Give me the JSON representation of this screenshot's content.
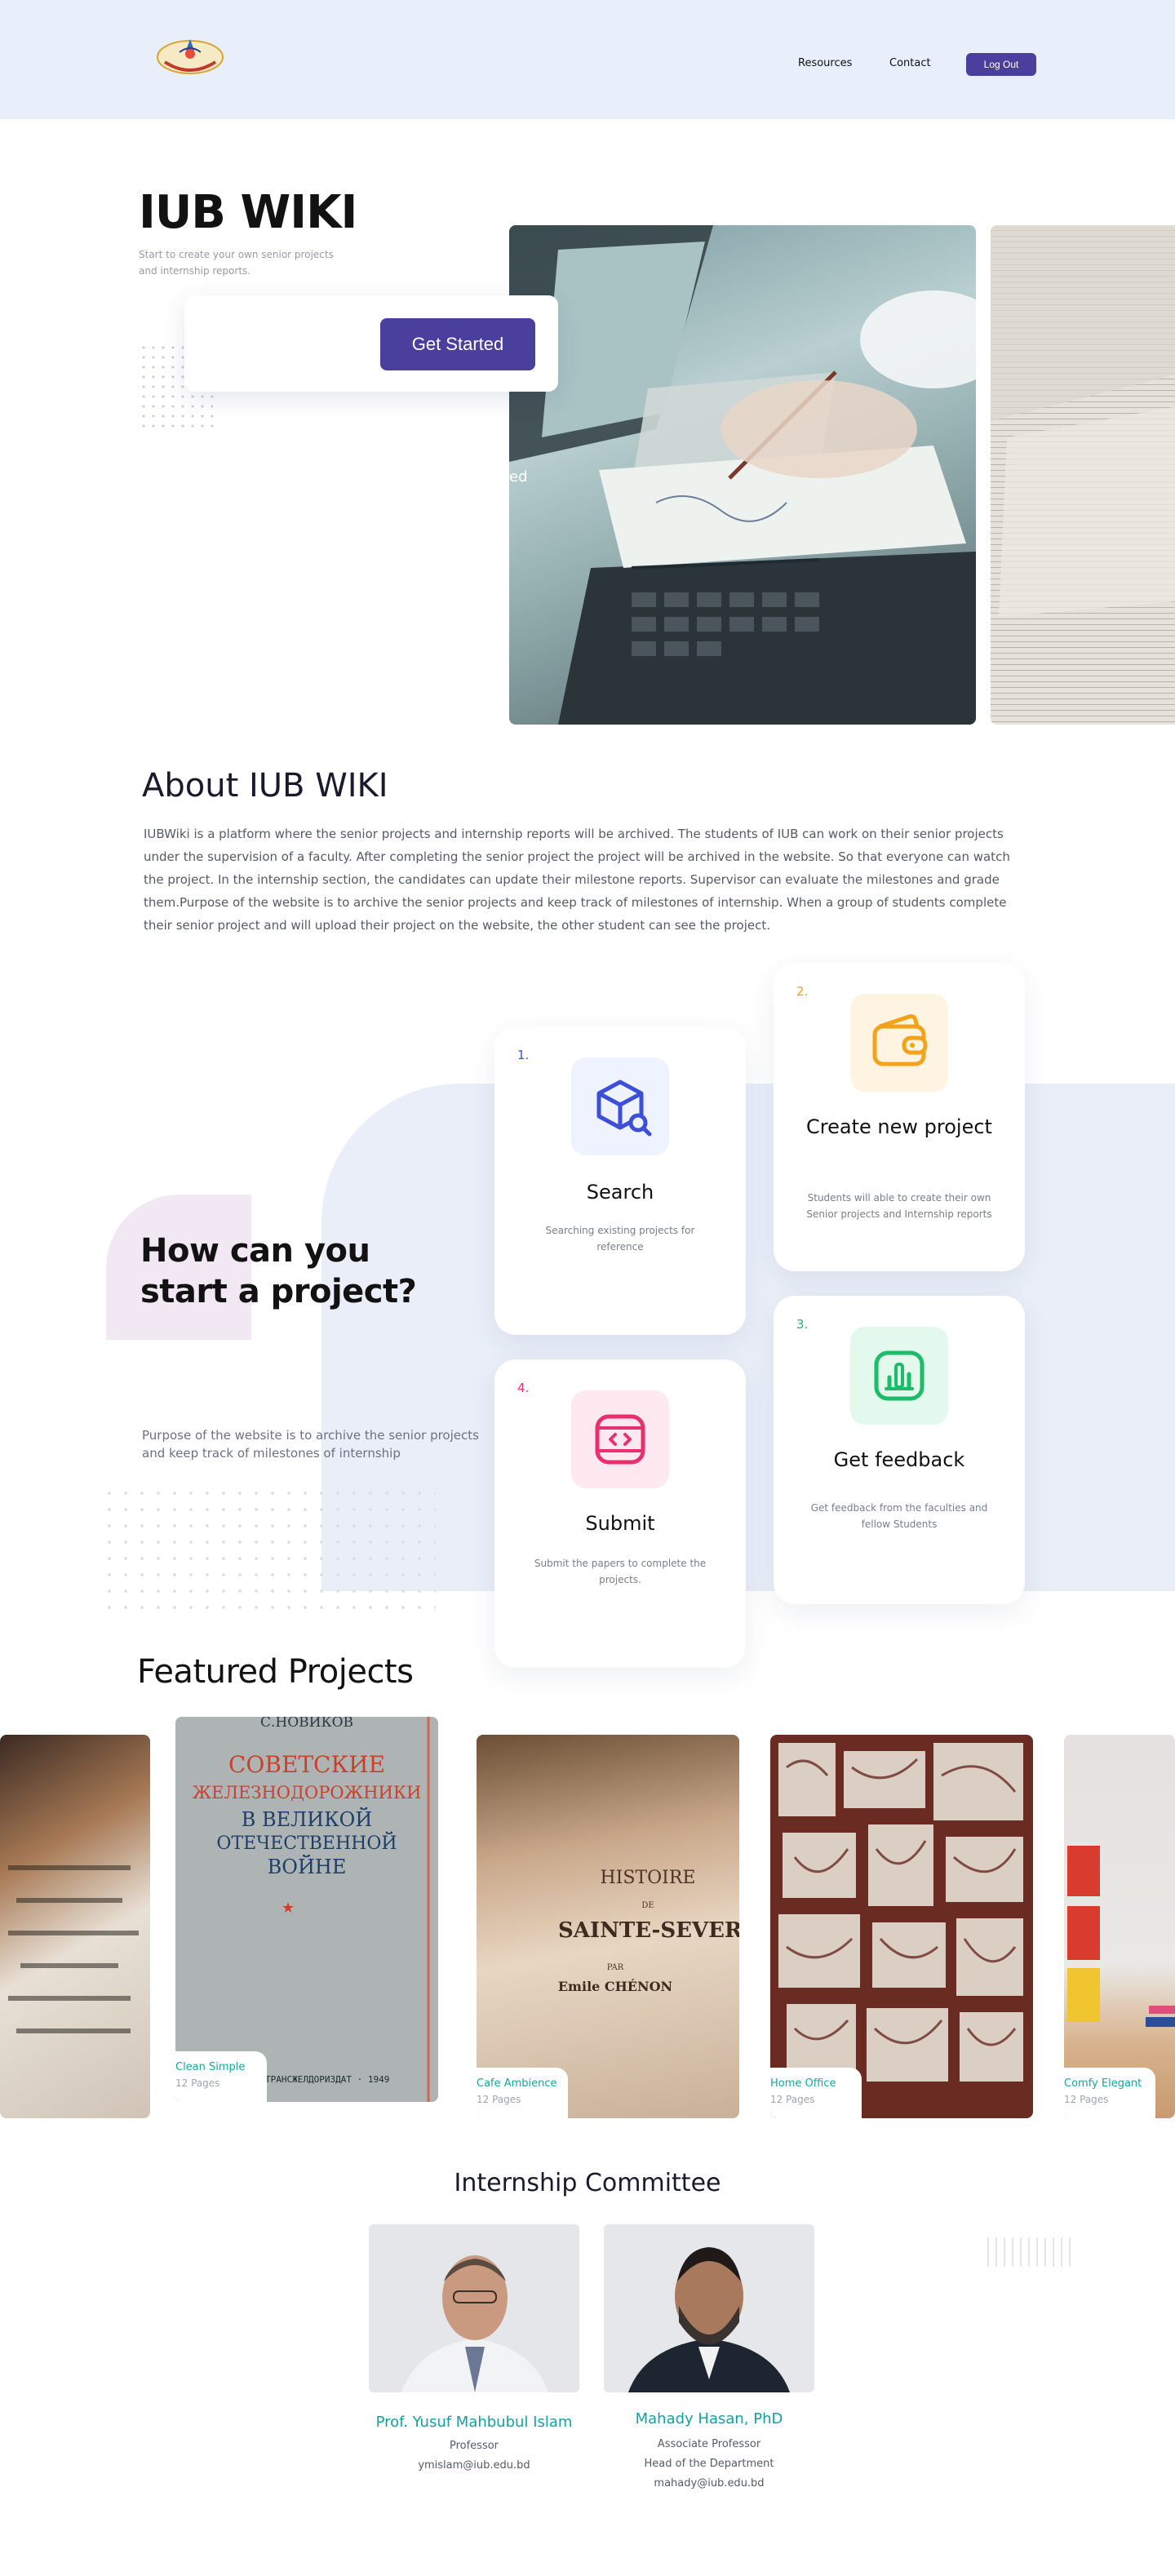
{
  "header": {
    "nav": [
      "Resources",
      "Contact"
    ],
    "logout_label": "Log Out"
  },
  "hero": {
    "title": "IUB WIKI",
    "subtitle": "Start to create your own senior projects and internship reports.",
    "cta_label": "Get Started",
    "fragment": "ed"
  },
  "about": {
    "title": "About IUB WIKI",
    "body": "IUBWiki is a platform where the senior projects and internship reports will be archived. The students of IUB can work on their senior projects under the supervision of a faculty. After completing the senior project the project will be archived in the website. So that everyone can watch the project. In the internship section, the candidates can update their milestone reports. Supervisor can evaluate the milestones and grade them.Purpose of the website is to archive the senior projects and keep track of milestones of internship. When a group of students complete their senior project and will upload their project on the website, the other student can see the project."
  },
  "how": {
    "title": "How can you start a project?",
    "description": "Purpose of the website is to archive the senior projects and keep track of milestones of internship",
    "steps": [
      {
        "num": "1.",
        "title": "Search",
        "desc": "Searching existing projects for reference",
        "icon": "search-box-icon",
        "color": "#3d4fd6",
        "bg": "#eef3ff"
      },
      {
        "num": "2.",
        "title": "Create new project",
        "desc": "Students will able to create their own Senior projects and Internship reports",
        "icon": "wallet-icon",
        "color": "#f3a21b",
        "bg": "#fff4e2"
      },
      {
        "num": "3.",
        "title": "Get feedback",
        "desc": "Get feedback from the faculties and fellow Students",
        "icon": "chart-icon",
        "color": "#1dbb6a",
        "bg": "#e3f9ee"
      },
      {
        "num": "4.",
        "title": "Submit",
        "desc": "Submit the papers to complete  the projects.",
        "icon": "code-box-icon",
        "color": "#e8306f",
        "bg": "#ffe9f1"
      }
    ]
  },
  "featured": {
    "title": "Featured Projects",
    "projects": [
      {
        "name": "Clean Simple",
        "pages": "12 Pages"
      },
      {
        "name": "Cafe Ambience",
        "pages": "12 Pages"
      },
      {
        "name": "Home Office",
        "pages": "12 Pages"
      },
      {
        "name": "Comfy Elegant",
        "pages": "12 Pages"
      }
    ],
    "book1": {
      "author": "С.НОВИКОВ",
      "title_lines": [
        "СОВЕТСКИЕ",
        "ЖЕЛЕЗНОДОРОЖНИКИ",
        "В ВЕЛИКОЙ",
        "ОТЕЧЕСТВЕННОЙ",
        "ВОЙНЕ"
      ],
      "imprint": "ТРАНСЖЕЛДОРИЗДАТ · 1949"
    },
    "book2": {
      "lines": [
        "HISTOIRE",
        "DE",
        "SAINTE-SEVERE-EN-BERRY",
        "PAR",
        "Emile CHÉNON"
      ]
    }
  },
  "committee": {
    "title": "Internship Committee",
    "members": [
      {
        "name": "Prof. Yusuf Mahbubul Islam",
        "lines": [
          "Professor",
          "ymislam@iub.edu.bd"
        ]
      },
      {
        "name": "Mahady Hasan, PhD",
        "lines": [
          "Associate Professor",
          "Head of the Department",
          "mahady@iub.edu.bd"
        ]
      }
    ]
  },
  "colors": {
    "primary": "#4a3f9c",
    "accent_teal": "#14a0a0",
    "header_bg": "#e8eefa"
  }
}
